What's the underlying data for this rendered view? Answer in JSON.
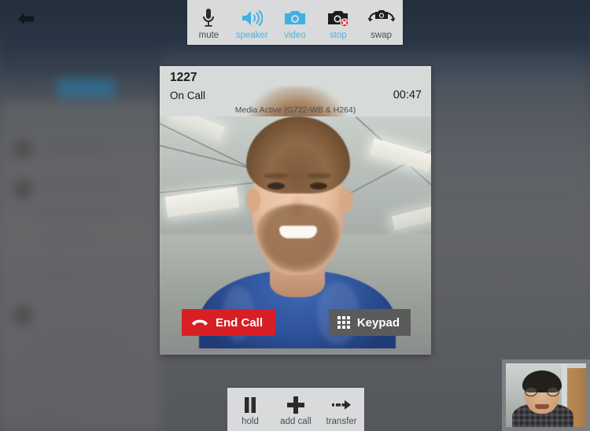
{
  "app": {
    "back_icon": "back-arrow-icon"
  },
  "media_toolbar": {
    "items": [
      {
        "label": "mute",
        "icon": "microphone-icon",
        "state": "off"
      },
      {
        "label": "speaker",
        "icon": "speaker-on-icon",
        "state": "on"
      },
      {
        "label": "video",
        "icon": "camera-icon",
        "state": "on"
      },
      {
        "label": "stop",
        "icon": "camera-stop-icon",
        "state": "on"
      },
      {
        "label": "swap",
        "icon": "camera-swap-icon",
        "state": "off"
      }
    ]
  },
  "call": {
    "number": "1227",
    "status": "On Call",
    "timer": "00:47",
    "media_status": "Media Active (G722-WB & H264)",
    "end_call_label": "End Call",
    "end_call_icon": "phone-hangup-icon",
    "keypad_label": "Keypad",
    "keypad_icon": "keypad-grid-icon",
    "remote_video_name": "remote-video-feed",
    "self_video_name": "self-video-pip"
  },
  "call_toolbar": {
    "items": [
      {
        "label": "hold",
        "icon": "pause-icon"
      },
      {
        "label": "add call",
        "icon": "plus-icon"
      },
      {
        "label": "transfer",
        "icon": "transfer-arrow-icon"
      }
    ]
  },
  "colors": {
    "accent_blue": "#49b3e5",
    "end_call_red": "#d81f26",
    "toolbar_bg": "#d8dadb",
    "keypad_gray": "#5b5b5b",
    "header_bg": "#d6dbd9"
  }
}
